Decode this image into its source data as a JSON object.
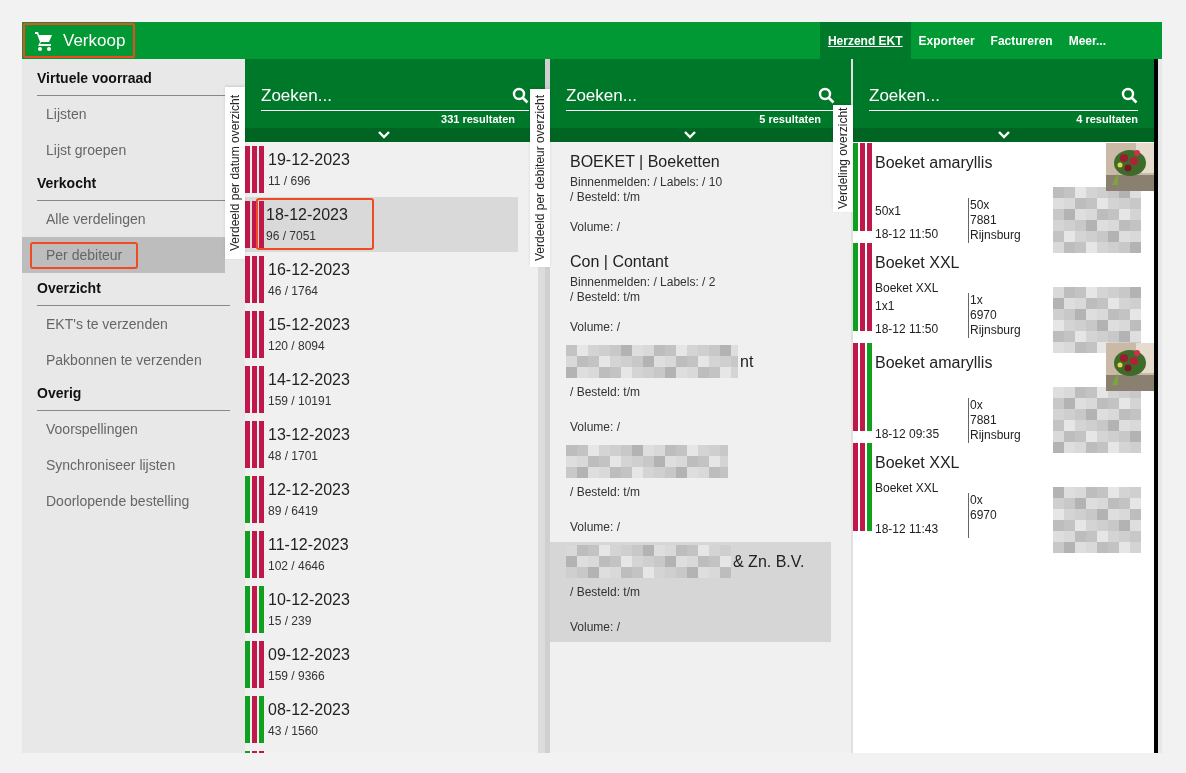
{
  "header": {
    "title": "Verkoop",
    "highlighted": true,
    "nav": [
      {
        "label": "Herzend EKT",
        "selected": true
      },
      {
        "label": "Exporteer",
        "selected": false
      },
      {
        "label": "Factureren",
        "selected": false
      },
      {
        "label": "Meer...",
        "selected": false
      }
    ]
  },
  "sidebar": {
    "groups": [
      {
        "title": "Virtuele voorraad",
        "items": [
          {
            "label": "Lijsten",
            "selected": false,
            "highlighted": false
          },
          {
            "label": "Lijst groepen",
            "selected": false,
            "highlighted": false
          }
        ]
      },
      {
        "title": "Verkocht",
        "items": [
          {
            "label": "Alle verdelingen",
            "selected": false,
            "highlighted": false
          },
          {
            "label": "Per debiteur",
            "selected": true,
            "highlighted": true
          }
        ]
      },
      {
        "title": "Overzicht",
        "items": [
          {
            "label": "EKT's te verzenden",
            "selected": false,
            "highlighted": false
          },
          {
            "label": "Pakbonnen te verzenden",
            "selected": false,
            "highlighted": false
          }
        ]
      },
      {
        "title": "Overig",
        "items": [
          {
            "label": "Voorspellingen",
            "selected": false,
            "highlighted": false
          },
          {
            "label": "Synchroniseer lijsten",
            "selected": false,
            "highlighted": false
          },
          {
            "label": "Doorlopende bestelling",
            "selected": false,
            "highlighted": false
          }
        ]
      }
    ]
  },
  "dates_panel": {
    "side_tab": "Verdeeld per datum overzicht",
    "search": {
      "placeholder": "Zoeken..."
    },
    "results": "331 resultaten",
    "items": [
      {
        "date": "19-12-2023",
        "count": "11 / 696",
        "selected": false,
        "highlighted": false,
        "bars": [
          {
            "color": "#c0184a"
          },
          {
            "color": "#c0184a"
          },
          {
            "color": "#c0184a"
          }
        ]
      },
      {
        "date": "18-12-2023",
        "count": "96 / 7051",
        "selected": true,
        "highlighted": true,
        "bars": [
          {
            "color": "#c0184a"
          },
          {
            "color": "#c0184a"
          },
          {
            "color": "#c0184a"
          }
        ]
      },
      {
        "date": "16-12-2023",
        "count": "46 / 1764",
        "selected": false,
        "highlighted": false,
        "bars": [
          {
            "color": "#c0184a"
          },
          {
            "color": "#c0184a"
          },
          {
            "color": "#c0184a"
          }
        ]
      },
      {
        "date": "15-12-2023",
        "count": "120 / 8094",
        "selected": false,
        "highlighted": false,
        "bars": [
          {
            "color": "#c0184a"
          },
          {
            "color": "#c0184a"
          },
          {
            "color": "#c0184a"
          }
        ]
      },
      {
        "date": "14-12-2023",
        "count": "159 / 10191",
        "selected": false,
        "highlighted": false,
        "bars": [
          {
            "color": "#c0184a"
          },
          {
            "color": "#c0184a"
          },
          {
            "color": "#c0184a"
          }
        ]
      },
      {
        "date": "13-12-2023",
        "count": "48 / 1701",
        "selected": false,
        "highlighted": false,
        "bars": [
          {
            "color": "#c0184a"
          },
          {
            "color": "#c0184a"
          },
          {
            "color": "#c0184a"
          }
        ]
      },
      {
        "date": "12-12-2023",
        "count": "89 / 6419",
        "selected": false,
        "highlighted": false,
        "bars": [
          {
            "color": "#0ea01e"
          },
          {
            "color": "#c0184a"
          },
          {
            "color": "#c0184a"
          }
        ]
      },
      {
        "date": "11-12-2023",
        "count": "102 / 4646",
        "selected": false,
        "highlighted": false,
        "bars": [
          {
            "color": "#0ea01e"
          },
          {
            "color": "#c0184a"
          },
          {
            "color": "#c0184a"
          }
        ]
      },
      {
        "date": "10-12-2023",
        "count": "15 / 239",
        "selected": false,
        "highlighted": false,
        "bars": [
          {
            "color": "#0ea01e"
          },
          {
            "color": "#c0184a"
          },
          {
            "color": "#0ea01e"
          }
        ]
      },
      {
        "date": "09-12-2023",
        "count": "159 / 9366",
        "selected": false,
        "highlighted": false,
        "bars": [
          {
            "color": "#0ea01e"
          },
          {
            "color": "#c0184a"
          },
          {
            "color": "#c0184a"
          }
        ]
      },
      {
        "date": "08-12-2023",
        "count": "43 / 1560",
        "selected": false,
        "highlighted": false,
        "bars": [
          {
            "color": "#0ea01e"
          },
          {
            "color": "#c0184a"
          },
          {
            "color": "#0ea01e"
          }
        ]
      },
      {
        "selected": false,
        "highlighted": false,
        "bars": [
          {
            "color": "#0ea01e"
          },
          {
            "color": "#c0184a"
          },
          {
            "color": "#c0184a"
          }
        ]
      }
    ]
  },
  "debtors_panel": {
    "side_tab": "Verdeeld per debiteur overzicht",
    "search": {
      "placeholder": "Zoeken..."
    },
    "results": "5 resultaten",
    "items": [
      {
        "title": "BOEKET | Boeketten",
        "masked": false,
        "selected": false,
        "lines": [
          "Binnenmelden: / Labels: / 10",
          "/ Besteld: t/m"
        ],
        "volume": "Volume: /"
      },
      {
        "title": "Con | Contant",
        "masked": false,
        "selected": false,
        "lines": [
          "Binnenmelden: / Labels: / 2",
          "/ Besteld: t/m"
        ],
        "volume": "Volume: /"
      },
      {
        "title": "nt",
        "masked": true,
        "selected": false,
        "lines": [
          "/ Besteld: t/m"
        ],
        "volume": "Volume: /"
      },
      {
        "masked": true,
        "selected": false,
        "lines": [
          "/ Besteld: t/m"
        ],
        "volume": "Volume: /"
      },
      {
        "title": "& Zn. B.V.",
        "masked": true,
        "selected": true,
        "lines": [
          "/ Besteld: t/m"
        ],
        "volume": "Volume: /"
      }
    ]
  },
  "distribution_panel": {
    "side_tab": "Verdeling overzicht",
    "search": {
      "placeholder": "Zoeken..."
    },
    "results": "4 resultaten",
    "items": [
      {
        "title": "Boeket amaryllis",
        "quantity": "50x1",
        "time": "18-12 11:50",
        "details": [
          "50x",
          "7881",
          "Rijnsburg"
        ],
        "photo": {
          "kind": "picture"
        },
        "bars": [
          {
            "color": "#0ea01e"
          },
          {
            "color": "#c0184a"
          },
          {
            "color": "#c0184a"
          }
        ]
      },
      {
        "title": "Boeket XXL",
        "subtitle": "Boeket XXL",
        "quantity": "1x1",
        "time": "18-12 11:50",
        "details": [
          "1x",
          "6970",
          "Rijnsburg"
        ],
        "bars": [
          {
            "color": "#0ea01e"
          },
          {
            "color": "#c0184a"
          },
          {
            "color": "#c0184a"
          }
        ]
      },
      {
        "title": "Boeket amaryllis",
        "time": "18-12 09:35",
        "details": [
          "0x",
          "7881",
          "Rijnsburg"
        ],
        "photo": {
          "kind": "picture"
        },
        "bars": [
          {
            "color": "#c0184a"
          },
          {
            "color": "#c0184a"
          },
          {
            "color": "#0ea01e"
          }
        ]
      },
      {
        "title": "Boeket XXL",
        "subtitle": "Boeket XXL",
        "time": "18-12 11:43",
        "details": [
          "0x",
          "6970"
        ],
        "bars": [
          {
            "color": "#c0184a"
          },
          {
            "color": "#c0184a"
          },
          {
            "color": "#0ea01e"
          }
        ]
      }
    ]
  }
}
